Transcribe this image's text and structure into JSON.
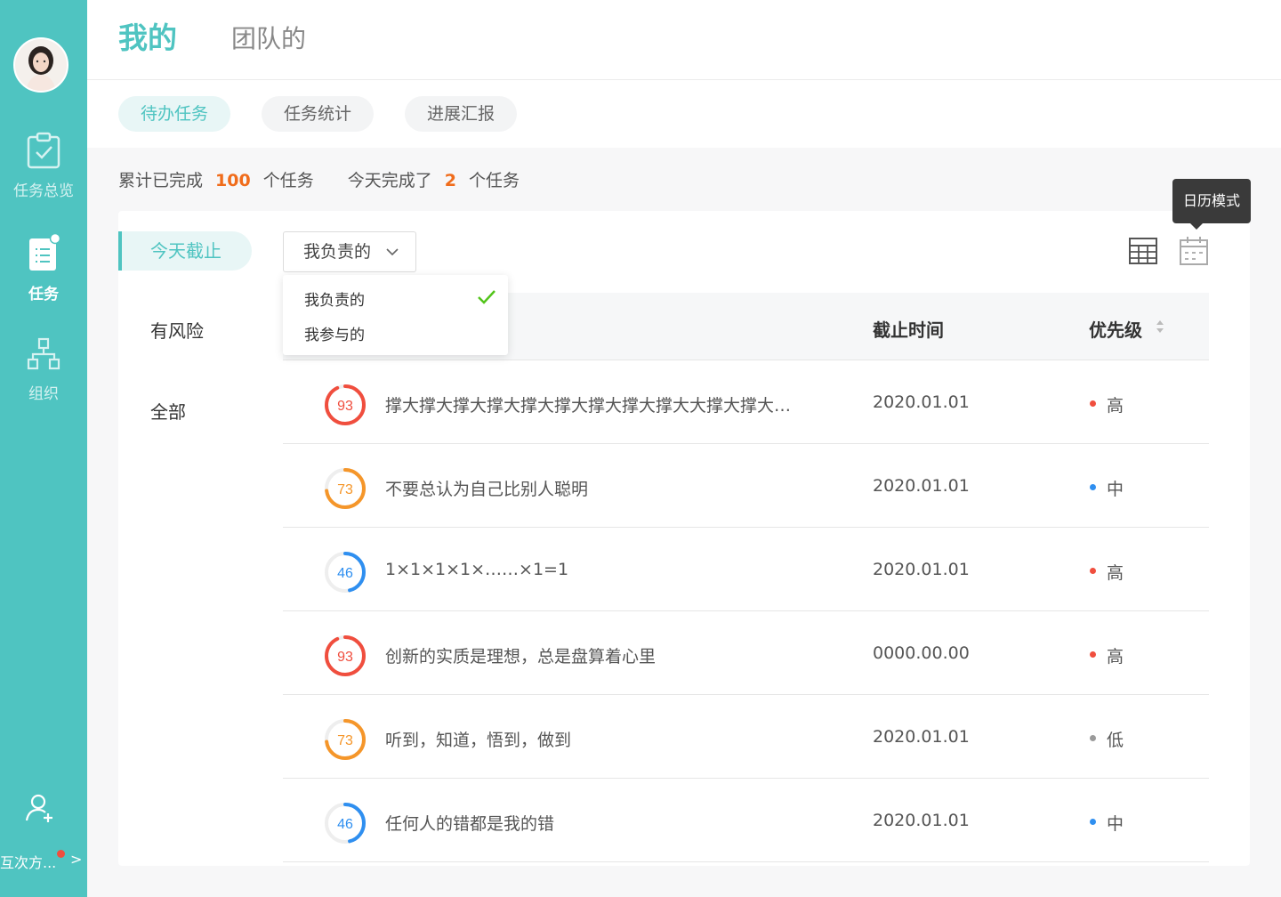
{
  "header": {
    "tabs": [
      {
        "label": "我的",
        "active": true
      },
      {
        "label": "团队的",
        "active": false
      }
    ]
  },
  "subnav": {
    "pills": [
      {
        "label": "待办任务",
        "active": true
      },
      {
        "label": "任务统计",
        "active": false
      },
      {
        "label": "进展汇报",
        "active": false
      }
    ]
  },
  "sidebar": {
    "items": [
      {
        "label": "任务总览",
        "icon": "clipboard-check-icon",
        "active": false
      },
      {
        "label": "任务",
        "icon": "task-list-icon",
        "active": true,
        "badge_color": "#ffffff"
      },
      {
        "label": "组织",
        "icon": "org-chart-icon",
        "active": false
      }
    ],
    "bottom": {
      "label": "互次方...",
      "icon": "add-user-icon",
      "chevron": ">",
      "badge_color": "#f04e3e"
    },
    "accent": "#4fc4c1"
  },
  "summary": {
    "prefix1": "累计已完成",
    "count1": "100",
    "suffix1": "个任务",
    "prefix2": "今天完成了",
    "count2": "2",
    "suffix2": "个任务"
  },
  "left_menu": [
    {
      "label": "今天截止",
      "active": true
    },
    {
      "label": "有风险",
      "active": false
    },
    {
      "label": "全部",
      "active": false
    }
  ],
  "filter": {
    "selected": "我负责的",
    "options": [
      {
        "label": "我负责的",
        "checked": true
      },
      {
        "label": "我参与的",
        "checked": false
      }
    ]
  },
  "view_modes": {
    "tooltip": "日历模式",
    "icons": [
      "table-view-icon",
      "calendar-view-icon"
    ]
  },
  "table": {
    "columns": {
      "deadline": "截止时间",
      "priority": "优先级"
    },
    "rows": [
      {
        "progress": 93,
        "title": "撑大撑大撑大撑大撑大撑大撑大撑大撑大大撑大撑大撑大撑大撑大撑",
        "date": "2020.01.01",
        "priority": "高",
        "priority_color": "#f04e3e"
      },
      {
        "progress": 73,
        "title": "不要总认为自己比别人聪明",
        "date": "2020.01.01",
        "priority": "中",
        "priority_color": "#2f8ff0"
      },
      {
        "progress": 46,
        "title": "1×1×1×1×……×1=1",
        "date": "2020.01.01",
        "priority": "高",
        "priority_color": "#f04e3e"
      },
      {
        "progress": 93,
        "title": "创新的实质是理想，总是盘算着心里",
        "date": "0000.00.00",
        "priority": "高",
        "priority_color": "#f04e3e"
      },
      {
        "progress": 73,
        "title": "听到，知道，悟到，做到",
        "date": "2020.01.01",
        "priority": "低",
        "priority_color": "#9a9a9a"
      },
      {
        "progress": 46,
        "title": "任何人的错都是我的错",
        "date": "2020.01.01",
        "priority": "中",
        "priority_color": "#2f8ff0"
      }
    ]
  },
  "colors": {
    "ring_high": "#f04e3e",
    "ring_mid": "#f5962a",
    "ring_low": "#2f8ff0"
  }
}
